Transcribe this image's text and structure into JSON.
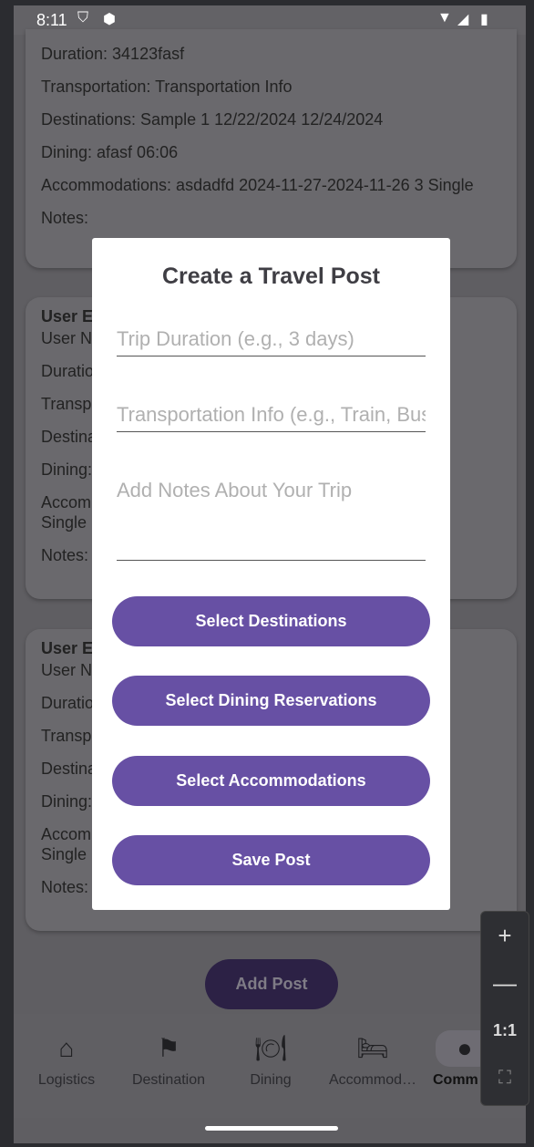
{
  "status_bar": {
    "time": "8:11"
  },
  "cards": [
    {
      "lines": [
        "Duration: 34123fasf",
        "Transportation: Transportation Info",
        "Destinations: Sample 1 12/22/2024 12/24/2024",
        "Dining: afasf 06:06",
        "Accommodations: asdadfd 2024-11-27-2024-11-26 3 Single",
        "Notes:"
      ]
    },
    {
      "title": "User E",
      "user": "User N",
      "lines": [
        "Duratio",
        "Transp",
        "Destina",
        "Dining:",
        "Accom\nSingle",
        "Notes:"
      ]
    },
    {
      "title": "User E",
      "user": "User N",
      "lines": [
        "Duratio",
        "Transp",
        "Destina",
        "Dining:",
        "Accom\nSingle",
        "Notes:"
      ]
    }
  ],
  "modal": {
    "title": "Create a Travel Post",
    "duration_placeholder": "Trip Duration (e.g., 3 days)",
    "transport_placeholder": "Transportation Info (e.g., Train, Bus)",
    "notes_placeholder": "Add Notes About Your Trip",
    "buttons": [
      "Select Destinations",
      "Select Dining Reservations",
      "Select Accommodations",
      "Save Post"
    ],
    "button_color": "#6750a4"
  },
  "add_post": "Add Post",
  "nav": [
    {
      "label": "Logistics",
      "icon": "home-icon"
    },
    {
      "label": "Destination",
      "icon": "flag-icon"
    },
    {
      "label": "Dining",
      "icon": "dining-icon"
    },
    {
      "label": "Accommod…",
      "icon": "bed-icon"
    },
    {
      "label": "Comm",
      "icon": "community-icon",
      "active": true
    }
  ],
  "zoom_controls": {
    "one_to_one": "1:1"
  }
}
